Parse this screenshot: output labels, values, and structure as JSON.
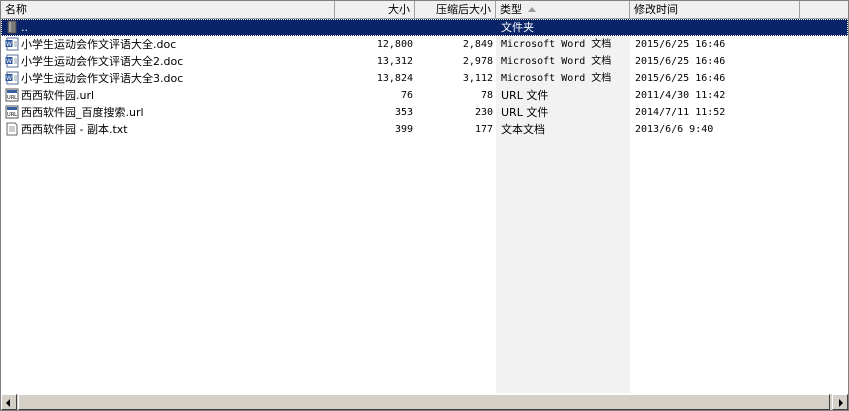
{
  "columns": {
    "name": "名称",
    "size": "大小",
    "packed": "压缩后大小",
    "type": "类型",
    "modified": "修改时间"
  },
  "sort": {
    "column": "type",
    "direction": "ascending"
  },
  "rows": [
    {
      "icon": "folder-up-icon",
      "name": "..",
      "size": "",
      "packed": "",
      "type": "文件夹",
      "modified": "",
      "selected": true
    },
    {
      "icon": "word-doc-icon",
      "name": "小学生运动会作文评语大全.doc",
      "size": "12,800",
      "packed": "2,849",
      "type": "Microsoft Word 文档",
      "modified": "2015/6/25 16:46"
    },
    {
      "icon": "word-doc-icon",
      "name": "小学生运动会作文评语大全2.doc",
      "size": "13,312",
      "packed": "2,978",
      "type": "Microsoft Word 文档",
      "modified": "2015/6/25 16:46"
    },
    {
      "icon": "word-doc-icon",
      "name": "小学生运动会作文评语大全3.doc",
      "size": "13,824",
      "packed": "3,112",
      "type": "Microsoft Word 文档",
      "modified": "2015/6/25 16:46"
    },
    {
      "icon": "url-shortcut-icon",
      "name": "西西软件园.url",
      "size": "76",
      "packed": "78",
      "type": "URL 文件",
      "modified": "2011/4/30 11:42"
    },
    {
      "icon": "url-shortcut-icon",
      "name": "西西软件园_百度搜索.url",
      "size": "353",
      "packed": "230",
      "type": "URL 文件",
      "modified": "2014/7/11 11:52"
    },
    {
      "icon": "text-file-icon",
      "name": "西西软件园 - 副本.txt",
      "size": "399",
      "packed": "177",
      "type": "文本文档",
      "modified": "2013/6/6 9:40"
    }
  ],
  "colors": {
    "selection": "#0a246a",
    "header": "#f0f0f0",
    "type_column": "#f2f2f2",
    "scrollbar": "#d4d0c8"
  }
}
